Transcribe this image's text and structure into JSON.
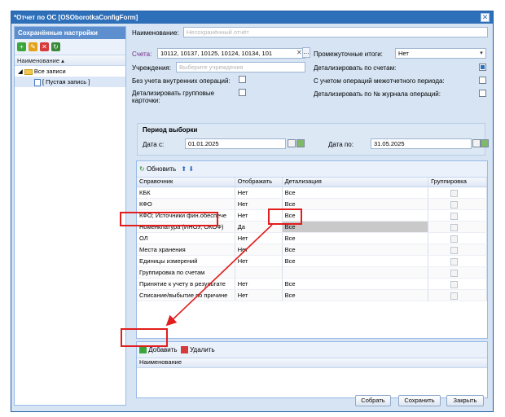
{
  "window": {
    "title": "*Отчет по ОС [OSOborotkaConfigForm]"
  },
  "left_panel": {
    "header": "Сохранённые настройки",
    "column_header": "Наименование",
    "tree": [
      {
        "label": "Все записи"
      },
      {
        "label": "[ Пустая запись ]"
      }
    ]
  },
  "form": {
    "name_label": "Наименование:",
    "name_placeholder": "Несохранённый отчёт",
    "accounts_label": "Счета:",
    "accounts_value": "10112, 10137, 10125, 10124, 10134, 101",
    "institutions_label": "Учреждения:",
    "institutions_placeholder": "Выберите учреждения",
    "subtotals_label": "Промежуточные итоги:",
    "subtotals_value": "Нет",
    "detail_accounts_label": "Детализировать по счетам:",
    "no_internal_label": "Без учета внутренних операций:",
    "inter_period_label": "С учетом операций межотчетного периода:",
    "detail_group_label": "Детализировать групповые карточки:",
    "detail_journal_label": "Детализировать по № журнала операций:"
  },
  "period": {
    "title": "Период выборки",
    "from_label": "Дата с:",
    "from_value": "01.01.2025",
    "to_label": "Дата по:",
    "to_value": "31.05.2025"
  },
  "grid": {
    "refresh_label": "Обновить",
    "columns": [
      "Справочник",
      "Отображать",
      "Детализация",
      "Группировка"
    ],
    "rows": [
      [
        "КБК",
        "Нет",
        "Все"
      ],
      [
        "КФО",
        "Нет",
        "Все"
      ],
      [
        "КФО; Источники фин.обеспече",
        "Нет",
        "Все"
      ],
      [
        "Номенклатура (ИНОУ, ОКОФ)",
        "Да",
        "Все"
      ],
      [
        "ОЛ",
        "Нет",
        "Все"
      ],
      [
        "Места хранения",
        "Нет",
        "Все"
      ],
      [
        "Единицы измерений",
        "Нет",
        "Все"
      ],
      [
        "Группировка по счетам",
        "",
        ""
      ],
      [
        "Принятие к учету в результате",
        "Нет",
        "Все"
      ],
      [
        "Списание/выбытие по причине",
        "Нет",
        "Все"
      ]
    ]
  },
  "bottom_grid": {
    "add_label": "Добавить",
    "delete_label": "Удалить",
    "column": "Наименование"
  },
  "footer": {
    "save": "Собрать",
    "save_as": "Сохранить",
    "close": "Закрыть"
  },
  "colors": {
    "title_bar": "#2d6fb8",
    "highlight": "#e11d1d"
  }
}
